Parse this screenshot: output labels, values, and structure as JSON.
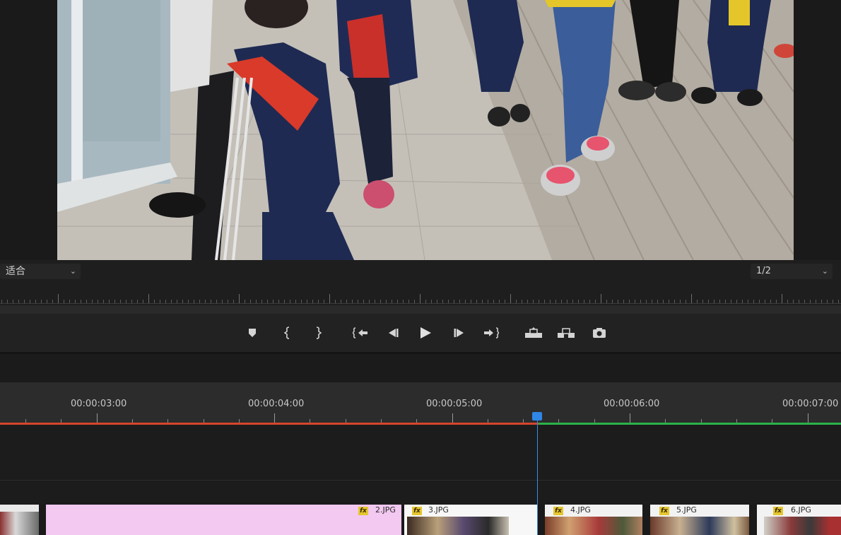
{
  "monitor": {
    "zoom_value": "适合",
    "resolution_value": "1/2"
  },
  "transport": {
    "buttons": [
      {
        "name": "add-marker-button",
        "icon": "marker-icon"
      },
      {
        "name": "mark-in-button",
        "icon": "mark-in-icon"
      },
      {
        "name": "mark-out-button",
        "icon": "mark-out-icon"
      },
      {
        "name": "go-to-in-button",
        "icon": "go-to-in-icon"
      },
      {
        "name": "step-back-button",
        "icon": "step-back-icon"
      },
      {
        "name": "play-button",
        "icon": "play-icon"
      },
      {
        "name": "step-forward-button",
        "icon": "step-forward-icon"
      },
      {
        "name": "go-to-out-button",
        "icon": "go-to-out-icon"
      },
      {
        "name": "lift-button",
        "icon": "lift-icon"
      },
      {
        "name": "extract-button",
        "icon": "extract-icon"
      },
      {
        "name": "export-frame-button",
        "icon": "camera-icon"
      }
    ]
  },
  "timeline": {
    "timecodes": [
      "00:00:03:00",
      "00:00:04:00",
      "00:00:05:00",
      "00:00:06:00",
      "00:00:07:00"
    ],
    "clips": [
      {
        "name": ""
      },
      {
        "name": "2.JPG",
        "fx": "fx"
      },
      {
        "name": "3.JPG",
        "fx": "fx"
      },
      {
        "name": "4.JPG",
        "fx": "fx"
      },
      {
        "name": "5.JPG",
        "fx": "fx"
      },
      {
        "name": "6.JPG",
        "fx": "fx"
      }
    ],
    "colors": {
      "clip": "#f3c8f1",
      "playhead": "#2f86e6",
      "render_red": "#d6452b",
      "render_green": "#2ab24a"
    }
  }
}
